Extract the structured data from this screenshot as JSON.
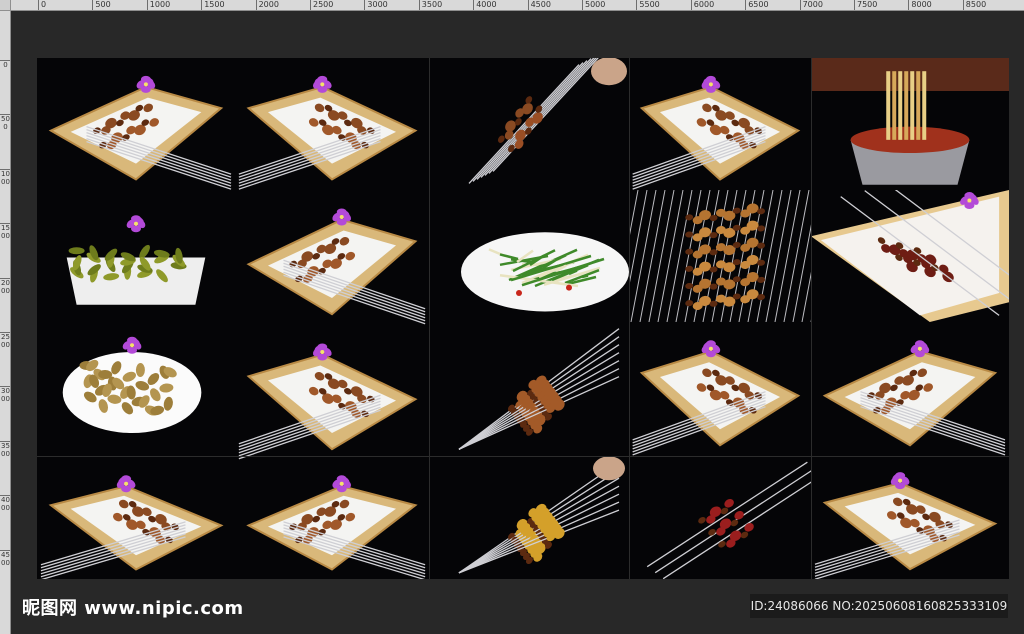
{
  "ruler": {
    "top_labels": [
      "0",
      "500",
      "1000",
      "1500",
      "2000",
      "2500",
      "3000",
      "3500",
      "4000",
      "4500",
      "5000",
      "5500",
      "6000",
      "6500",
      "7000",
      "7500",
      "8000",
      "8500"
    ],
    "left_labels": [
      "0",
      "500",
      "1000",
      "1500",
      "2000",
      "2500",
      "3000",
      "3500",
      "4000",
      "4500"
    ]
  },
  "photos": [
    {
      "label": "tray-skewers-1"
    },
    {
      "label": "tray-skewers-2"
    },
    {
      "label": "skewers-held"
    },
    {
      "label": "tray-skewers-3"
    },
    {
      "label": "skewers-bucket"
    },
    {
      "label": "edamame-bowl"
    },
    {
      "label": "tray-skewers-4"
    },
    {
      "label": "salad-plate"
    },
    {
      "label": "grill-rack"
    },
    {
      "label": "meat-skewers-closeup"
    },
    {
      "label": "peanuts-plate"
    },
    {
      "label": "tray-skewers-5"
    },
    {
      "label": "skewer-fan"
    },
    {
      "label": "tray-skewers-6"
    },
    {
      "label": "tray-skewers-7"
    },
    {
      "label": "tray-skewers-8"
    },
    {
      "label": "tray-skewers-9"
    },
    {
      "label": "corn-skewers"
    },
    {
      "label": "red-meat-skewers"
    },
    {
      "label": "tray-skewers-10"
    }
  ],
  "colors": {
    "tray": "#d9b87a",
    "tray_edge": "#b98a45",
    "paper": "#f4f4f2",
    "meat": "#8a4a22",
    "meat_dark": "#5c2a10",
    "orchid": "#b34ad8",
    "steel": "#cfcfd4"
  },
  "watermark": {
    "brand": "昵图网 www.nipic.com",
    "id_text": "ID:24086066 NO:20250608160825333109"
  }
}
